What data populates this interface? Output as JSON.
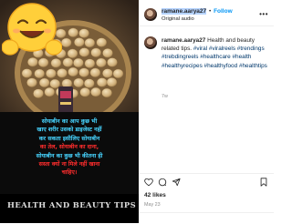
{
  "post": {
    "banner_text": "HEALTH AND BEAUTY TIPS",
    "overlay_lines": [
      {
        "text": "सोयाबीन का आप कुछ भी",
        "color": "cyan"
      },
      {
        "text": "खाए शरीर उसको डाइजेस्ट नहीं",
        "color": "cyan"
      },
      {
        "text": "कर सकता इसीलिए सोयाबीन",
        "color": "cyan"
      },
      {
        "text": "का तेल, सोयाबीन का दाना,",
        "color": "red"
      },
      {
        "text": "सोयाबीन का कुछ भी कीतना ही",
        "color": "cyan"
      },
      {
        "text": "सस्ता क्यों ना मिले नहीं खाना",
        "color": "red"
      },
      {
        "text": "चाहिए।",
        "color": "red"
      }
    ]
  },
  "header": {
    "username": "ramane.aarya27",
    "separator": "•",
    "follow_label": "Follow",
    "audio_label": "Original audio",
    "more_label": "•••"
  },
  "caption": {
    "username": "ramane.aarya27",
    "text": "Health and beauty related tips.",
    "hashtags": [
      "#viral",
      "#viralreels",
      "#trendings",
      "#trebdingreels",
      "#healthcare",
      "#health",
      "#healthyrecipes",
      "#healthyfood",
      "#healthtips"
    ],
    "time": "7w"
  },
  "stats": {
    "likes": "42 likes",
    "date": "May 23"
  },
  "icons": [
    "smiling-emoji-icon",
    "more-options-icon",
    "heart-icon",
    "comment-icon",
    "share-icon",
    "bookmark-icon"
  ],
  "colors": {
    "overlay_cyan": "#47d4ff",
    "overlay_red": "#ff2d2d",
    "follow_blue": "#0095f6",
    "hashtag_blue": "#00376b",
    "selection": "#b5d3ff"
  }
}
